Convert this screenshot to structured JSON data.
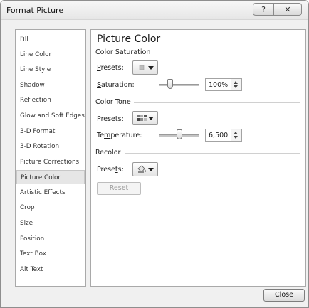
{
  "window": {
    "title": "Format Picture",
    "help_glyph": "?",
    "close_glyph": "✕"
  },
  "nav": {
    "items": [
      {
        "label": "Fill"
      },
      {
        "label": "Line Color"
      },
      {
        "label": "Line Style"
      },
      {
        "label": "Shadow"
      },
      {
        "label": "Reflection"
      },
      {
        "label": "Glow and Soft Edges"
      },
      {
        "label": "3-D Format"
      },
      {
        "label": "3-D Rotation"
      },
      {
        "label": "Picture Corrections"
      },
      {
        "label": "Picture Color"
      },
      {
        "label": "Artistic Effects"
      },
      {
        "label": "Crop"
      },
      {
        "label": "Size"
      },
      {
        "label": "Position"
      },
      {
        "label": "Text Box"
      },
      {
        "label": "Alt Text"
      }
    ],
    "selected": "Picture Color"
  },
  "pane": {
    "title": "Picture Color",
    "saturation": {
      "group_label": "Color Saturation",
      "presets_label_pre": "",
      "presets_label_key": "P",
      "presets_label_post": "resets:",
      "value_label_key": "S",
      "value_label_post": "aturation:",
      "value": "100%",
      "slider_fraction": 0.27
    },
    "tone": {
      "group_label": "Color Tone",
      "presets_label_pre": "P",
      "presets_label_key": "r",
      "presets_label_post": "esets:",
      "value_label_pre": "Te",
      "value_label_key": "m",
      "value_label_post": "perature:",
      "value": "6,500",
      "slider_fraction": 0.5
    },
    "recolor": {
      "group_label": "Recolor",
      "presets_label_pre": "Prese",
      "presets_label_key": "t",
      "presets_label_post": "s:",
      "reset_key": "R",
      "reset_post": "eset"
    }
  },
  "footer": {
    "close_label": "Close"
  },
  "colors": {
    "window_bg": "#f0f0f0",
    "selected_nav_bg": "#e6e6e6",
    "disabled_text": "#9a9a9a"
  },
  "icons": {
    "saturation_preset": "gray-swatch-icon",
    "tone_preset": "color-tone-preset-icon",
    "recolor_preset": "paint-bucket-icon"
  }
}
